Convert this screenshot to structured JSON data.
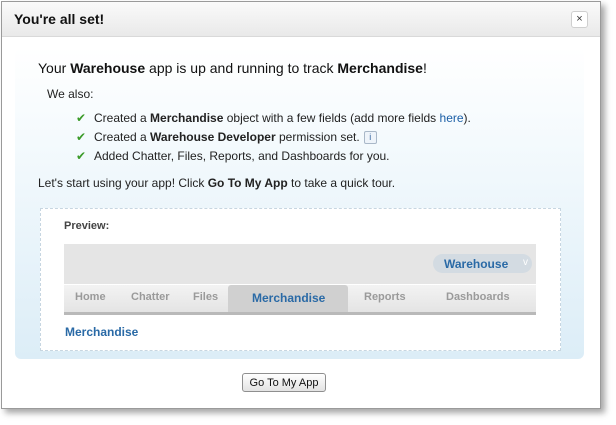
{
  "dialog": {
    "title": "You're all set!",
    "close_label": "×"
  },
  "headline": {
    "prefix": "Your ",
    "app_name": "Warehouse",
    "middle": " app is up and running to track ",
    "object_name": "Merchandise",
    "suffix": "!"
  },
  "we_also": "We also:",
  "items": [
    {
      "pre": "Created a ",
      "bold": "Merchandise",
      "post": " object with a few fields (add more fields ",
      "link": "here",
      "end": ")."
    },
    {
      "pre": "Created a ",
      "bold": "Warehouse Developer",
      "post": " permission set.",
      "info": "i"
    },
    {
      "text": "Added Chatter, Files, Reports, and Dashboards for you."
    }
  ],
  "check_glyph": "✔",
  "tour": {
    "pre": "Let's start using your app! Click ",
    "bold": "Go To My App",
    "post": " to take a quick tour."
  },
  "preview": {
    "label": "Preview:",
    "app_picker": "Warehouse",
    "app_picker_caret": "v",
    "tabs": [
      "Home",
      "Chatter",
      "Files",
      "Merchandise",
      "Reports",
      "Dashboards"
    ],
    "active_tab": "Merchandise",
    "page_name": "Merchandise"
  },
  "button": {
    "label": "Go To My App"
  },
  "colors": {
    "link": "#1a5ea6",
    "check": "#3a9a28",
    "active_tab_text": "#2a6aa6"
  }
}
